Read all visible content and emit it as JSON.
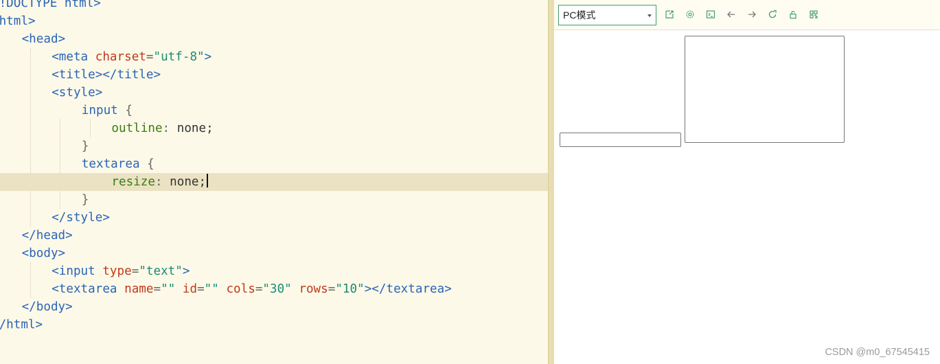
{
  "editor": {
    "lines": [
      [
        [
          "tag",
          "<!DOCTYPE html>"
        ]
      ],
      [
        [
          "tag",
          "<html>"
        ]
      ],
      [
        [
          "tag",
          "<head>"
        ]
      ],
      [
        [
          "tag",
          "<meta "
        ],
        [
          "attr",
          "charset"
        ],
        [
          "punct",
          "="
        ],
        [
          "str",
          "\"utf-8\""
        ],
        [
          "tag",
          ">"
        ]
      ],
      [
        [
          "tag",
          "<title></title>"
        ]
      ],
      [
        [
          "tag",
          "<style>"
        ]
      ],
      [
        [
          "sel",
          "input "
        ],
        [
          "brace",
          "{"
        ]
      ],
      [
        [
          "prop",
          "outline"
        ],
        [
          "punct",
          ": "
        ],
        [
          "val",
          "none;"
        ]
      ],
      [
        [
          "brace",
          "}"
        ]
      ],
      [
        [
          "sel",
          "textarea "
        ],
        [
          "brace",
          "{"
        ]
      ],
      [
        [
          "prop",
          "resize"
        ],
        [
          "punct",
          ": "
        ],
        [
          "val",
          "none;"
        ]
      ],
      [
        [
          "brace",
          "}"
        ]
      ],
      [
        [
          "tag",
          "</style>"
        ]
      ],
      [
        [
          "tag",
          "</head>"
        ]
      ],
      [
        [
          "tag",
          "<body>"
        ]
      ],
      [
        [
          "tag",
          "<input "
        ],
        [
          "attr",
          "type"
        ],
        [
          "punct",
          "="
        ],
        [
          "str",
          "\"text\""
        ],
        [
          "tag",
          ">"
        ]
      ],
      [
        [
          "tag",
          "<textarea "
        ],
        [
          "attr",
          "name"
        ],
        [
          "punct",
          "="
        ],
        [
          "str",
          "\"\""
        ],
        [
          "val",
          " "
        ],
        [
          "attr",
          "id"
        ],
        [
          "punct",
          "="
        ],
        [
          "str",
          "\"\""
        ],
        [
          "val",
          " "
        ],
        [
          "attr",
          "cols"
        ],
        [
          "punct",
          "="
        ],
        [
          "str",
          "\"30\""
        ],
        [
          "val",
          " "
        ],
        [
          "attr",
          "rows"
        ],
        [
          "punct",
          "="
        ],
        [
          "str",
          "\"10\""
        ],
        [
          "tag",
          "></textarea>"
        ]
      ],
      [
        [
          "tag",
          "</body>"
        ]
      ],
      [
        [
          "tag",
          "</html>"
        ]
      ]
    ],
    "current_line": 10
  },
  "preview": {
    "mode_select": {
      "value": "PC模式"
    },
    "toolbar_icons": [
      "external-window-icon",
      "settings-icon",
      "terminal-icon",
      "back-arrow-icon",
      "forward-arrow-icon",
      "refresh-icon",
      "lock-icon",
      "qr-code-icon"
    ],
    "accent_color": "#3f9c72"
  },
  "watermark": "CSDN @m0_67545415"
}
